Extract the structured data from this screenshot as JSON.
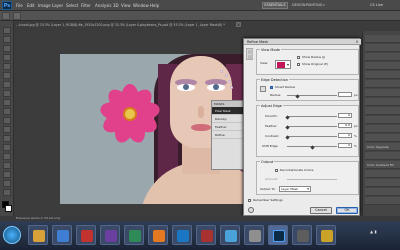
{
  "app": {
    "logo": "Ps"
  },
  "menubar": {
    "items": [
      "File",
      "Edit",
      "Image",
      "Layer",
      "Select",
      "Filter",
      "Analysis",
      "3D",
      "View",
      "Window",
      "Help"
    ],
    "essentials": "ESSENTIALS",
    "workspaces": [
      "DESIGN",
      "PAINTING",
      "»"
    ],
    "cs_live": "CS Live"
  },
  "tabs": [
    {
      "label": "...kinoid.jpg @ 33.3% (Layer 1, RGB/8) *"
    },
    {
      "label": "...ile_1920x1200.png @ 33.3% (Layer 0..."
    },
    {
      "label": "playbeans_Ps.psd @ 33.3% (Layer 1, Layer Mask/8) *"
    }
  ],
  "masks_panel": {
    "title": "MASKS",
    "rows": [
      "Pixel Mask",
      "Density:",
      "Feather:",
      "Refine:"
    ]
  },
  "right_panel": {
    "rows": [
      "",
      "",
      "",
      "",
      "",
      "",
      "",
      "",
      "",
      "",
      "",
      "",
      "Color Upgrade",
      "",
      "Color Gradient Fill",
      "",
      "",
      "",
      ""
    ]
  },
  "dialog": {
    "title": "Refine Mask",
    "view_mode": {
      "title": "View Mode",
      "view_label": "View:",
      "show_radius": "Show Radius (J)",
      "show_original": "Show Original (P)"
    },
    "edge_detection": {
      "title": "Edge Detection",
      "smart_radius": "Smart Radius",
      "radius_label": "Radius:",
      "radius_value": "",
      "radius_unit": "px"
    },
    "adjust_edge": {
      "title": "Adjust Edge",
      "rows": [
        {
          "label": "Smooth:",
          "value": "0",
          "unit": ""
        },
        {
          "label": "Feather:",
          "value": "0.0",
          "unit": "px"
        },
        {
          "label": "Contrast:",
          "value": "0",
          "unit": "%"
        },
        {
          "label": "Shift Edge:",
          "value": "0",
          "unit": "%"
        }
      ]
    },
    "output": {
      "title": "Output",
      "decontaminate": "Decontaminate Colors",
      "amount_label": "Amount:",
      "output_to_label": "Output To:",
      "output_to_value": "Layer Mask"
    },
    "remember": "Remember Settings",
    "cancel": "Cancel",
    "ok": "OK"
  },
  "status": {
    "text": "Exposure works in 32-bit only"
  },
  "colors": {
    "accent": "#3a7bd5",
    "flower": "#e0418a",
    "hair": "#3a1d2a"
  }
}
